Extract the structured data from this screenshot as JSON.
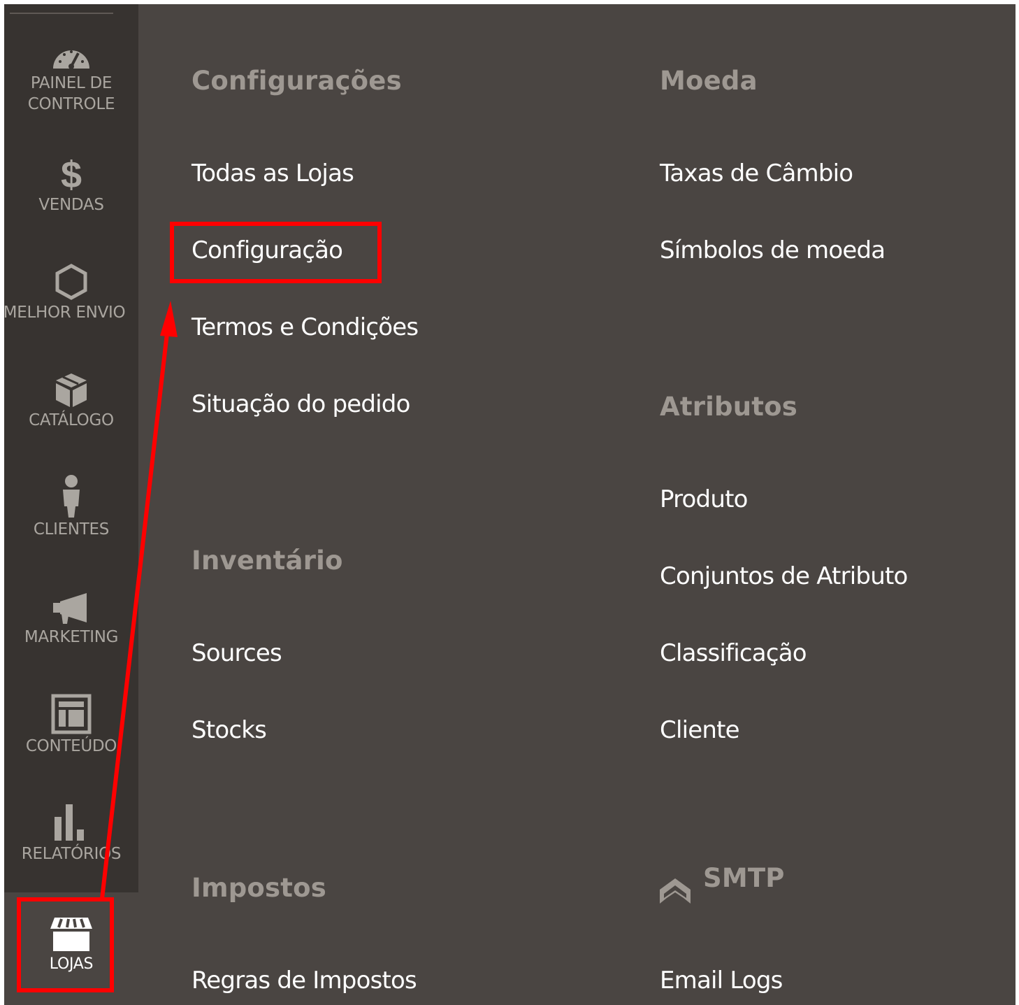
{
  "sidebar": {
    "items": [
      {
        "label": "PAINEL DE",
        "label2": "CONTROLE",
        "icon": "dashboard-gauge-icon"
      },
      {
        "label": "VENDAS",
        "icon": "dollar-icon"
      },
      {
        "label": "MELHOR ENVIO",
        "icon": "hexagon-icon"
      },
      {
        "label": "CATÁLOGO",
        "icon": "box-icon"
      },
      {
        "label": "CLIENTES",
        "icon": "person-icon"
      },
      {
        "label": "MARKETING",
        "icon": "megaphone-icon"
      },
      {
        "label": "CONTEÚDO",
        "icon": "layout-icon"
      },
      {
        "label": "RELATÓRIOS",
        "icon": "bar-chart-icon"
      },
      {
        "label": "LOJAS",
        "icon": "store-icon",
        "active": true
      }
    ]
  },
  "menu": {
    "col1": {
      "heading_config": "Configurações",
      "config_items": [
        "Todas as Lojas",
        "Configuração",
        "Termos e Condições",
        "Situação do pedido"
      ],
      "heading_inventory": "Inventário",
      "inventory_items": [
        "Sources",
        "Stocks"
      ],
      "heading_taxes": "Impostos",
      "taxes_items": [
        "Regras de Impostos"
      ]
    },
    "col2": {
      "heading_currency": "Moeda",
      "currency_items": [
        "Taxas de Câmbio",
        "Símbolos de moeda"
      ],
      "heading_attributes": "Atributos",
      "attribute_items": [
        "Produto",
        "Conjuntos de Atributo",
        "Classificação",
        "Cliente"
      ],
      "heading_smtp": "SMTP",
      "smtp_items": [
        "Email Logs"
      ]
    }
  },
  "annotation": {
    "color": "#ff0000"
  }
}
